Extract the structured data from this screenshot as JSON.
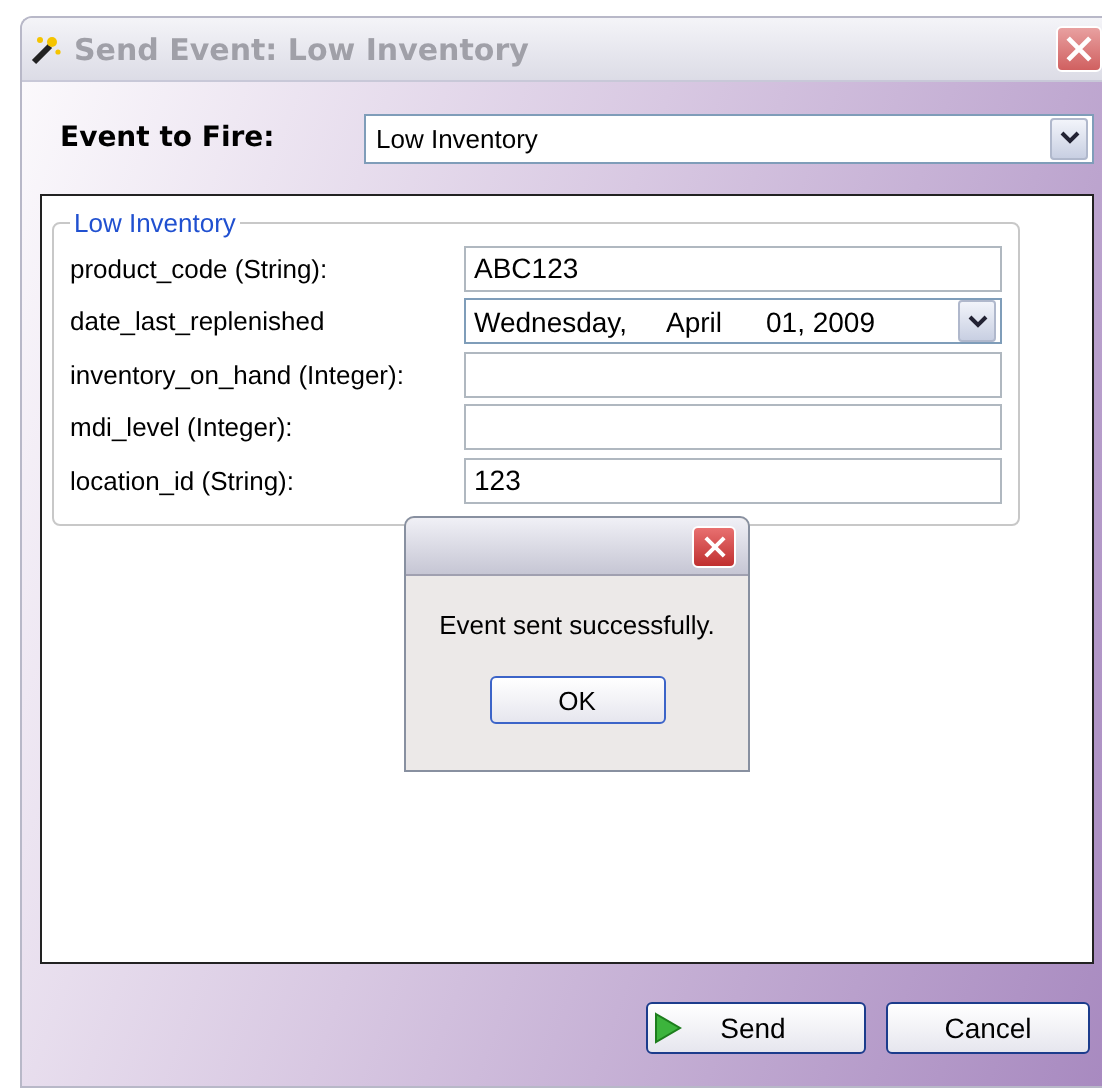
{
  "window": {
    "title": "Send Event: Low Inventory"
  },
  "event_selector": {
    "label": "Event to Fire:",
    "value": "Low Inventory"
  },
  "group": {
    "title": "Low Inventory",
    "fields": [
      {
        "kind": "text",
        "label": "product_code (String):",
        "value": "ABC123"
      },
      {
        "kind": "date",
        "label": "date_last_replenished",
        "weekday": "Wednesday,",
        "month": "April",
        "day_year": "01, 2009"
      },
      {
        "kind": "text",
        "label": "inventory_on_hand (Integer):"
      },
      {
        "kind": "text",
        "label": "mdi_level (Integer):"
      },
      {
        "kind": "text",
        "label": "location_id (String):",
        "value": "123"
      }
    ]
  },
  "message_box": {
    "message": "Event sent successfully.",
    "button": "OK"
  },
  "buttons": {
    "send": "Send",
    "cancel": "Cancel"
  }
}
